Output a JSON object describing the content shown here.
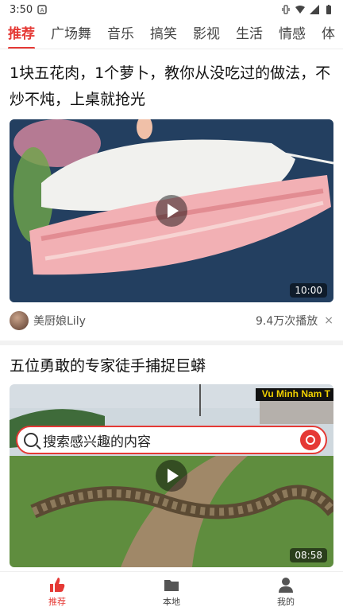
{
  "status_bar": {
    "time": "3:50"
  },
  "tabs": [
    {
      "label": "推荐",
      "active": true
    },
    {
      "label": "广场舞"
    },
    {
      "label": "音乐"
    },
    {
      "label": "搞笑"
    },
    {
      "label": "影视"
    },
    {
      "label": "生活"
    },
    {
      "label": "情感"
    },
    {
      "label": "体"
    }
  ],
  "feed": [
    {
      "title": "1块五花肉，1个萝卜，教你从没吃过的做法，不炒不炖，上桌就抢光",
      "duration": "10:00",
      "author": "美厨娘Lily",
      "views": "9.4万次播放",
      "close": "×"
    },
    {
      "title": "五位勇敢的专家徒手捕捉巨蟒",
      "duration": "08:58",
      "watermark": "Vu Minh Nam T"
    }
  ],
  "search": {
    "placeholder": "搜索感兴趣的内容"
  },
  "bottom_nav": [
    {
      "label": "推荐",
      "icon": "thumbs-up-icon",
      "active": true
    },
    {
      "label": "本地",
      "icon": "folder-icon"
    },
    {
      "label": "我的",
      "icon": "user-icon"
    }
  ],
  "colors": {
    "accent": "#e53935"
  }
}
